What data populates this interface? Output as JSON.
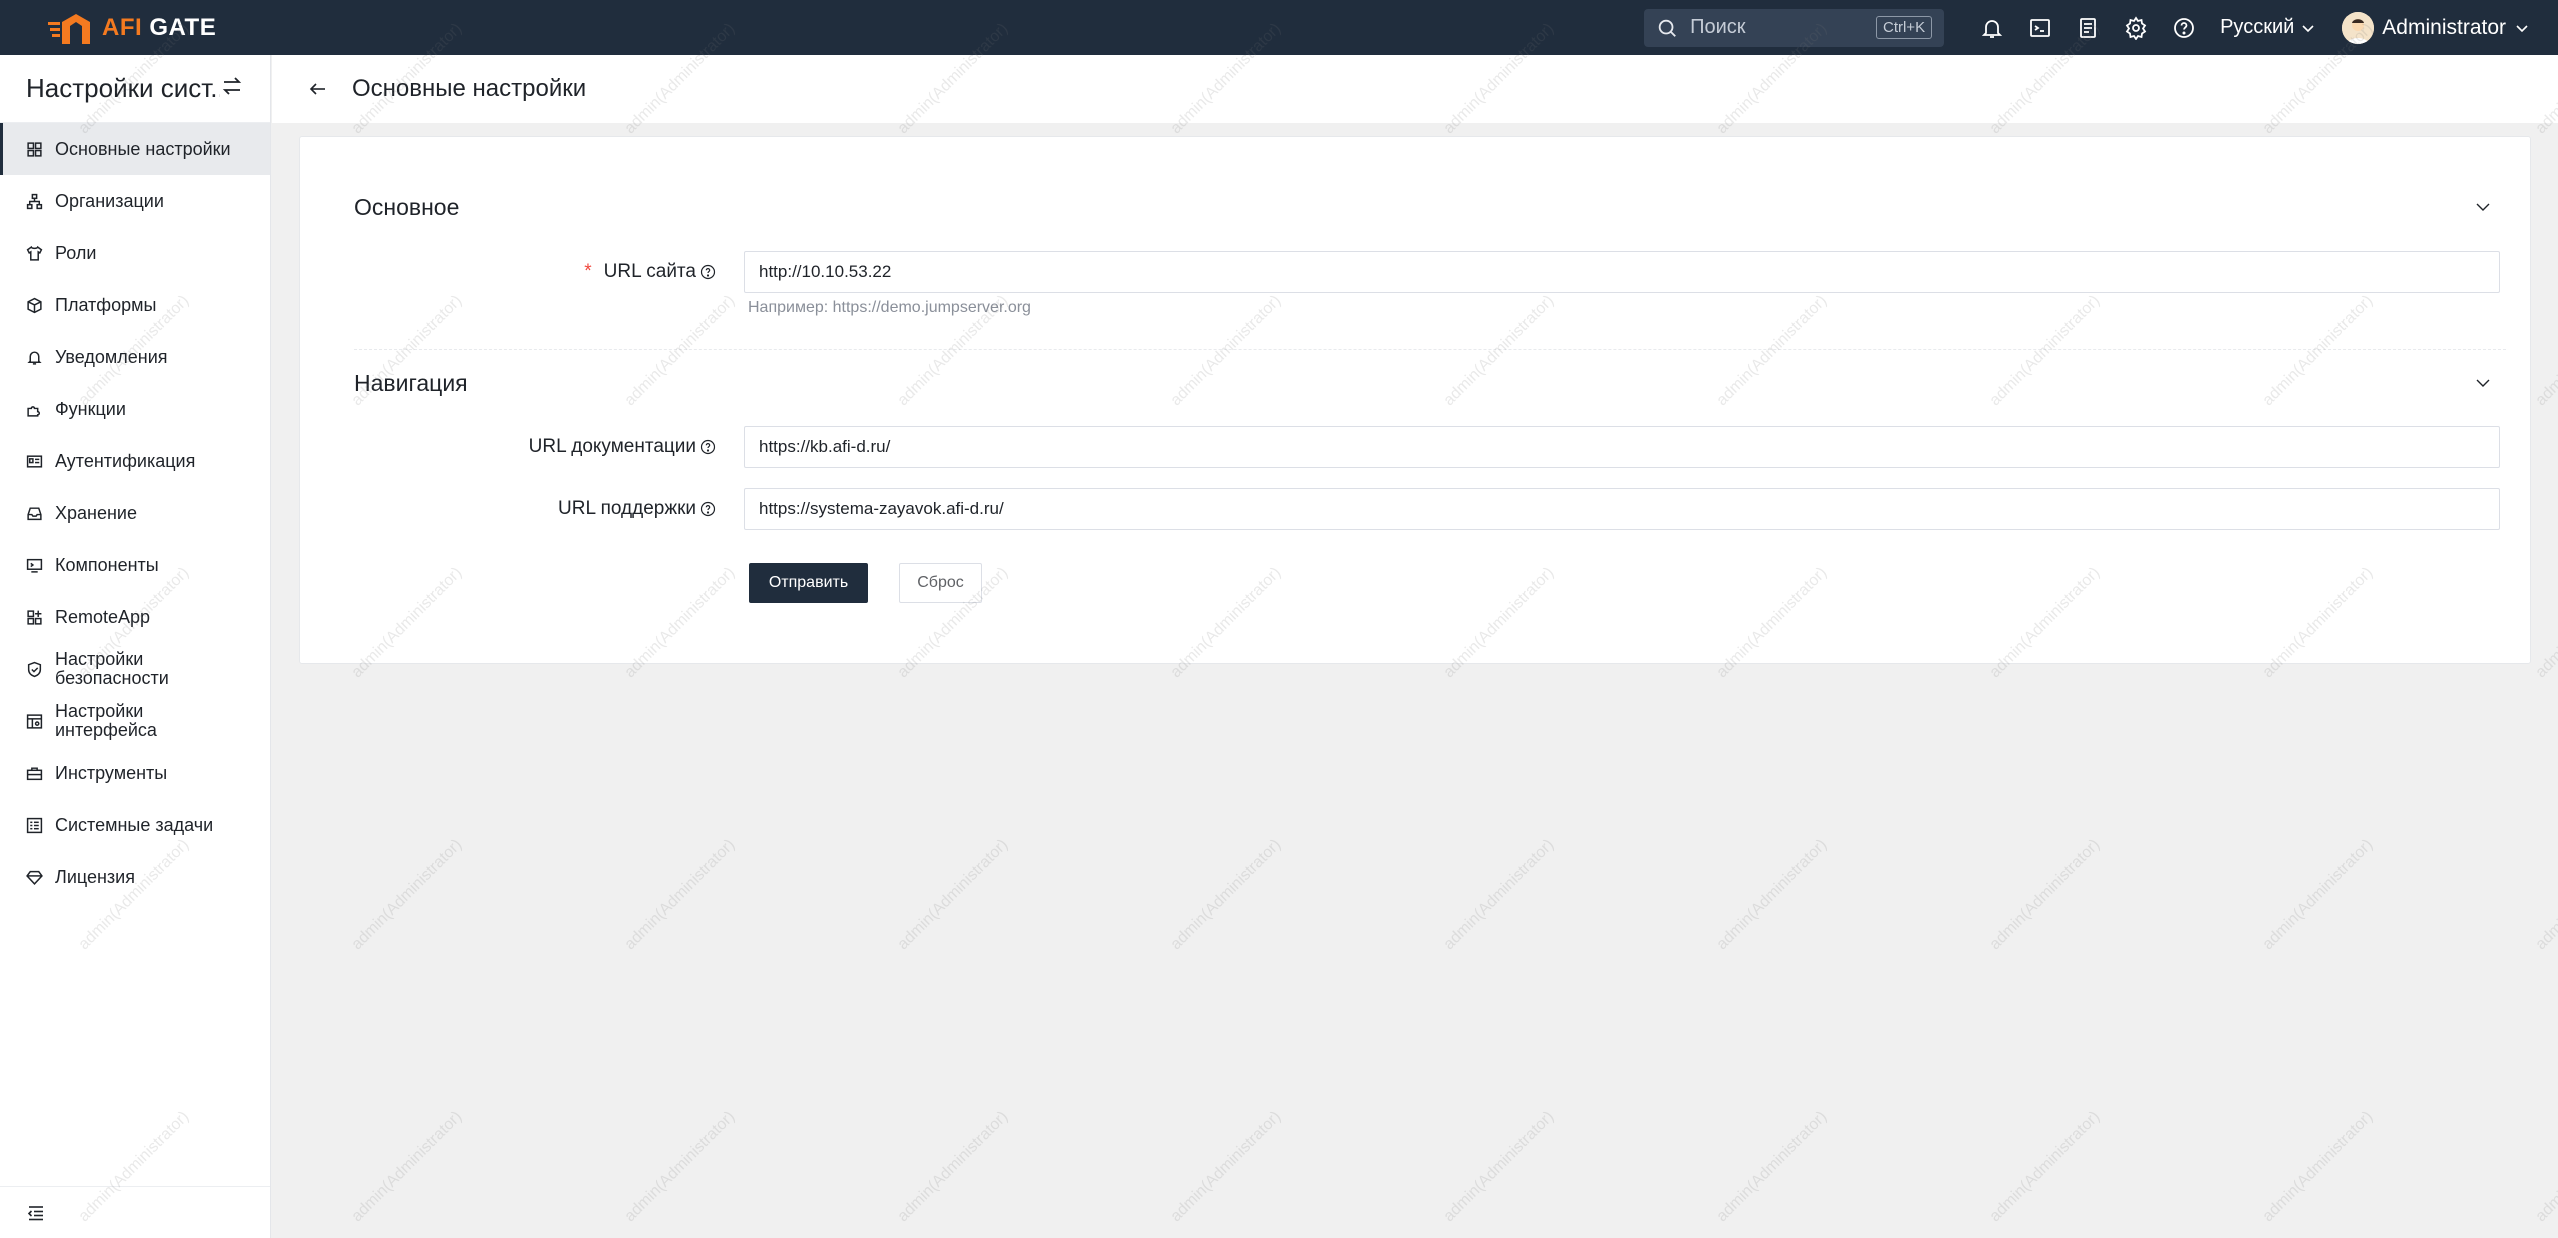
{
  "app": {
    "logo_prefix": "AFI",
    "logo_suffix": " GATE",
    "brand_color": "#f47a20",
    "topbar_color": "#202d3d"
  },
  "topbar": {
    "search_placeholder": "Поиск",
    "search_shortcut": "Ctrl+K",
    "icons": [
      "bell-icon",
      "terminal-icon",
      "clipboard-icon",
      "gear-icon",
      "help-icon"
    ],
    "language": "Русский",
    "user_name": "Administrator"
  },
  "sidebar": {
    "title": "Настройки сист...",
    "items": [
      {
        "label": "Основные настройки",
        "icon": "grid-icon",
        "active": true
      },
      {
        "label": "Организации",
        "icon": "org-tree-icon"
      },
      {
        "label": "Роли",
        "icon": "shirt-icon"
      },
      {
        "label": "Платформы",
        "icon": "cube-icon"
      },
      {
        "label": "Уведомления",
        "icon": "bell-icon"
      },
      {
        "label": "Функции",
        "icon": "puzzle-icon"
      },
      {
        "label": "Аутентификация",
        "icon": "id-card-icon"
      },
      {
        "label": "Хранение",
        "icon": "inbox-icon"
      },
      {
        "label": "Компоненты",
        "icon": "monitor-icon"
      },
      {
        "label": "RemoteApp",
        "icon": "apps-icon"
      },
      {
        "label_line1": "Настройки",
        "label_line2": "безопасности",
        "icon": "shield-icon"
      },
      {
        "label_line1": "Настройки",
        "label_line2": "интерфейса",
        "icon": "layout-icon"
      },
      {
        "label": "Инструменты",
        "icon": "toolbox-icon"
      },
      {
        "label": "Системные задачи",
        "icon": "task-list-icon"
      },
      {
        "label": "Лицензия",
        "icon": "diamond-icon"
      }
    ]
  },
  "page": {
    "title": "Основные настройки"
  },
  "form": {
    "section_basic": "Основное",
    "site_url_label": "URL сайта",
    "site_url_value": "http://10.10.53.22",
    "site_url_hint": "Например: https://demo.jumpserver.org",
    "section_nav": "Навигация",
    "docs_url_label": "URL документации",
    "docs_url_value": "https://kb.afi-d.ru/",
    "support_url_label": "URL поддержки",
    "support_url_value": "https://systema-zayavok.afi-d.ru/",
    "submit_label": "Отправить",
    "reset_label": "Сброс"
  },
  "watermark_text": "admin(Administrator)"
}
